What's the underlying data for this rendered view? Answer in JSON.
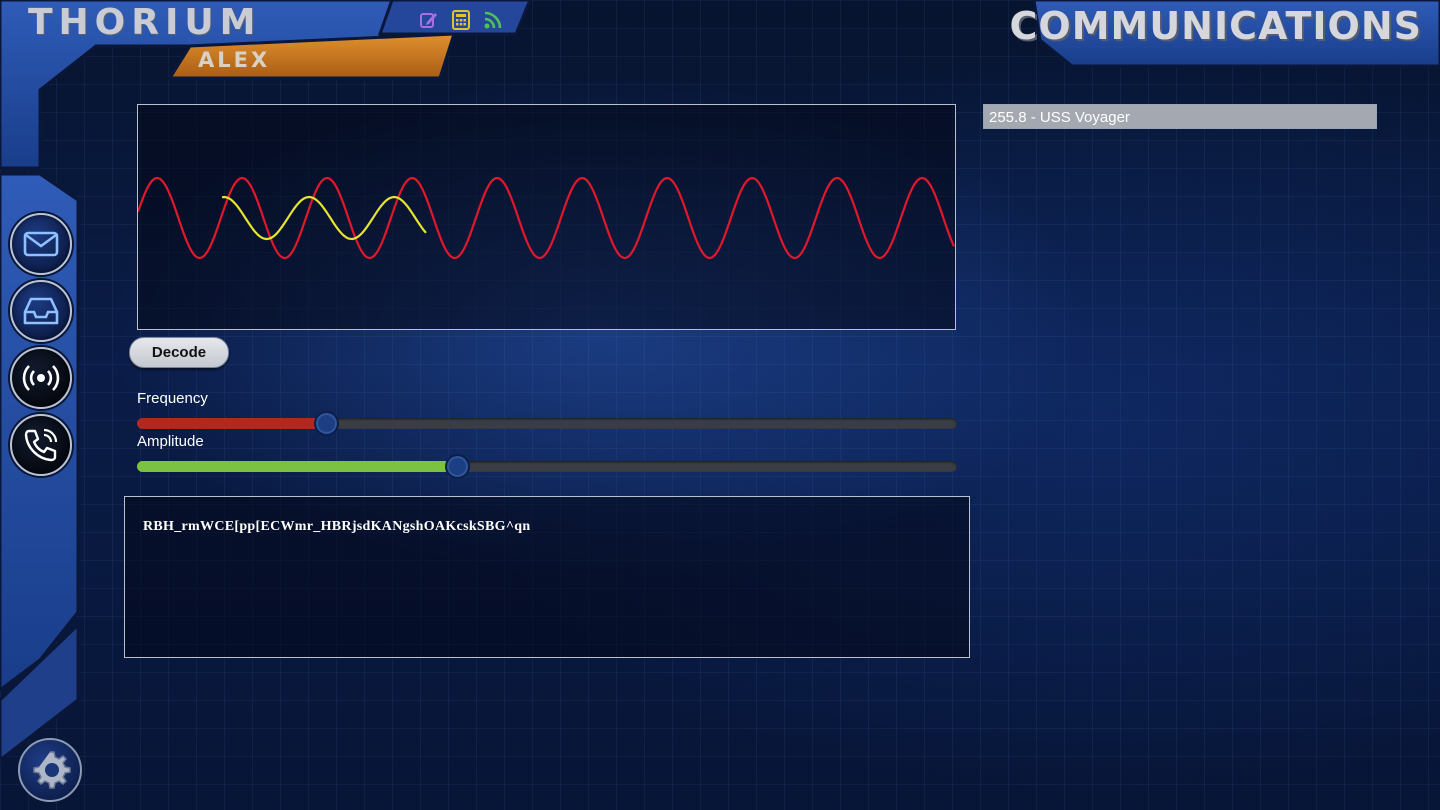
{
  "app": {
    "brand": "THORIUM",
    "user": "ALEX",
    "station_title": "COMMUNICATIONS"
  },
  "toolbar": {
    "icons": [
      "edit-icon",
      "calculator-icon",
      "rss-feed-icon"
    ],
    "colors": {
      "edit": "#a770e0",
      "calculator": "#e2c230",
      "rss": "#4fc05c"
    }
  },
  "sidebar": {
    "items": [
      {
        "icon": "mail-icon"
      },
      {
        "icon": "inbox-icon"
      },
      {
        "icon": "broadcast-icon"
      },
      {
        "icon": "phone-icon"
      }
    ],
    "settings_icon": "settings-gear-icon"
  },
  "waveform": {
    "colors": {
      "signal": "#e0182c",
      "tuning": "#e6e430"
    }
  },
  "decode_button": {
    "label": "Decode"
  },
  "frequency": {
    "label": "Frequency",
    "value": 0.23,
    "color": "#b0281f"
  },
  "amplitude": {
    "label": "Amplitude",
    "value": 0.39,
    "color": "#7cc242"
  },
  "output": {
    "text": "RBH_rmWCE[pp[ECWmr_HBRjsdKANgshOAKcskSBG^qn"
  },
  "channel": {
    "selected": "255.8 - USS Voyager"
  }
}
